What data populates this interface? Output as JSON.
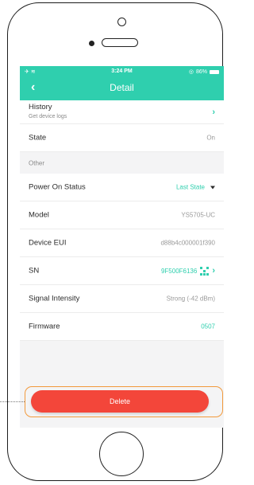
{
  "status_bar": {
    "time": "3:24 PM",
    "battery": "86%"
  },
  "nav": {
    "back_icon": "chevron-left-icon",
    "title": "Detail"
  },
  "rows": {
    "history": {
      "label": "History",
      "sub": "Get device logs"
    },
    "state": {
      "label": "State",
      "value": "On"
    },
    "section_other": "Other",
    "power_on_status": {
      "label": "Power On Status",
      "value": "Last State"
    },
    "model": {
      "label": "Model",
      "value": "YS5705-UC"
    },
    "device_eui": {
      "label": "Device EUI",
      "value": "d88b4c000001f390"
    },
    "sn": {
      "label": "SN",
      "value": "9F500F6136"
    },
    "signal": {
      "label": "Signal Intensity",
      "value": "Strong (-42 dBm)"
    },
    "firmware": {
      "label": "Firmware",
      "value": "0507"
    }
  },
  "delete_button": "Delete",
  "colors": {
    "accent": "#2fcfae",
    "danger": "#f3463a",
    "highlight": "#f29a3c"
  }
}
